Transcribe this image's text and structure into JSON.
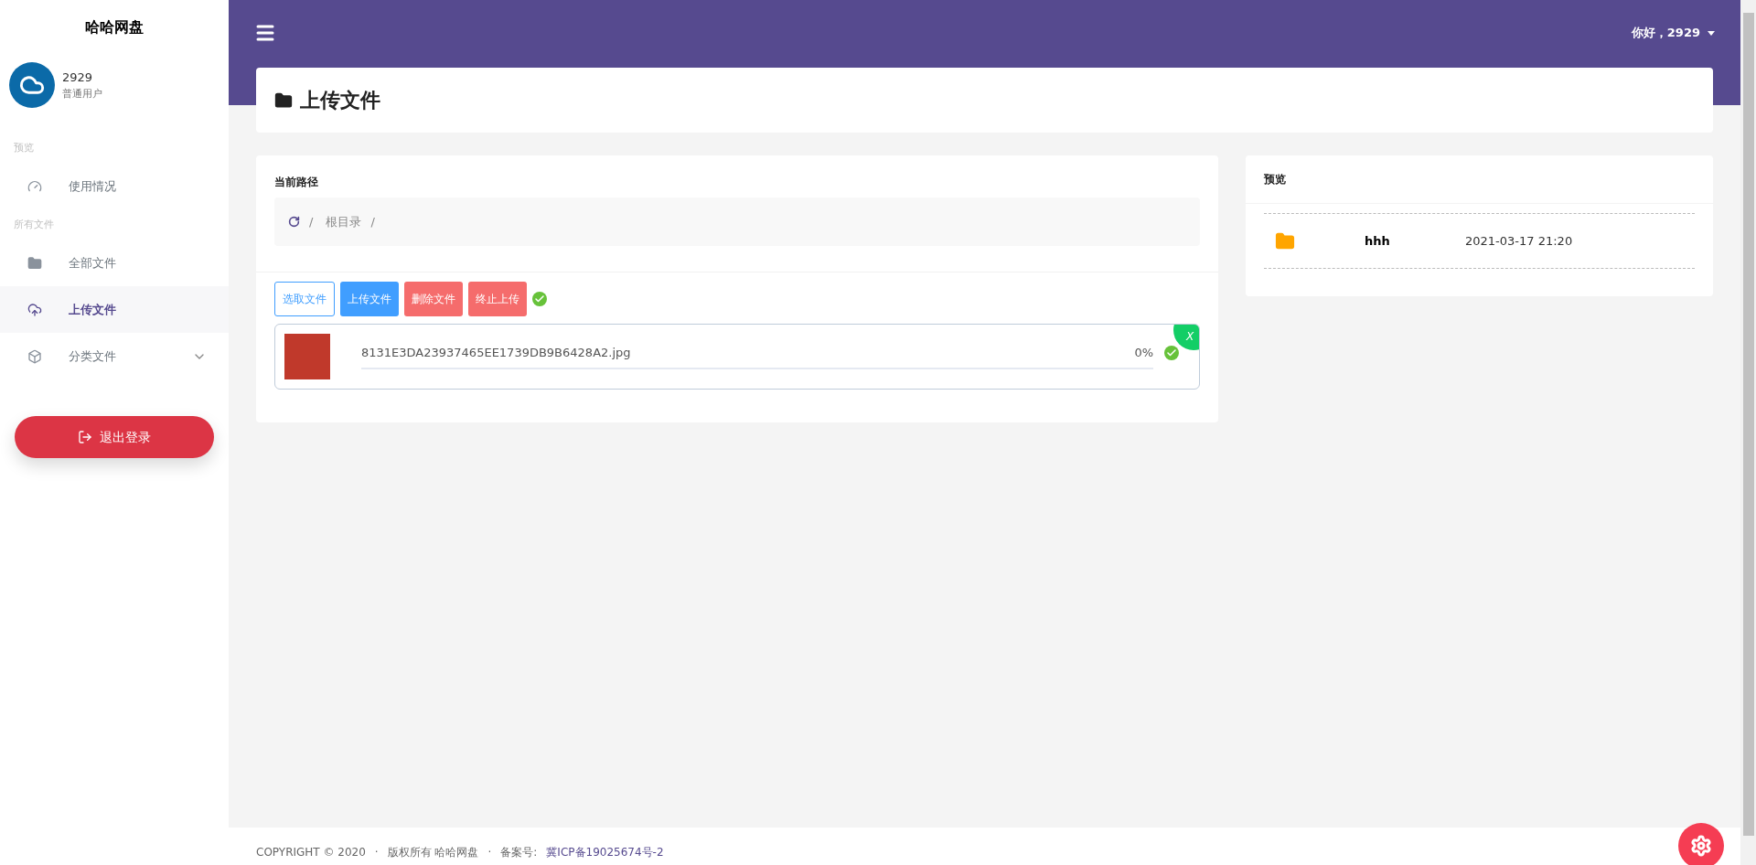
{
  "sidebar": {
    "brand": "哈哈网盘",
    "user": {
      "name": "2929",
      "role": "普通用户"
    },
    "sections": [
      {
        "heading": "预览",
        "items": [
          {
            "kind": "gauge",
            "label": "使用情况",
            "selected": false,
            "expandable": false
          }
        ]
      },
      {
        "heading": "所有文件",
        "items": [
          {
            "kind": "folder",
            "label": "全部文件",
            "selected": false,
            "expandable": false
          },
          {
            "kind": "upload",
            "label": "上传文件",
            "selected": true,
            "expandable": false
          },
          {
            "kind": "box",
            "label": "分类文件",
            "selected": false,
            "expandable": true
          }
        ]
      }
    ],
    "logout": "退出登录"
  },
  "topbar": {
    "greeting": "你好，2929"
  },
  "page_title": "上传文件",
  "upload": {
    "path_label": "当前路径",
    "separator": "/",
    "breadcrumb": [
      "根目录"
    ],
    "buttons": [
      {
        "kind": "outline",
        "label": "选取文件"
      },
      {
        "kind": "primary",
        "label": "上传文件"
      },
      {
        "kind": "danger",
        "label": "删除文件"
      },
      {
        "kind": "danger",
        "label": "终止上传"
      }
    ],
    "done": true,
    "files": [
      {
        "name": "8131E3DA23937465EE1739DB9B6428A2.jpg",
        "progress": "0%",
        "level": 0,
        "done": true,
        "remove": "X"
      }
    ]
  },
  "preview": {
    "title": "预览",
    "rows": [
      {
        "name": "hhh",
        "date": "2021-03-17 21:20"
      }
    ]
  },
  "footer": {
    "separator": "·",
    "copyright": "COPYRIGHT © 2020",
    "owner": "版权所有 哈哈网盘",
    "record_label": "备案号:",
    "record": "冀ICP备19025674号-2"
  }
}
